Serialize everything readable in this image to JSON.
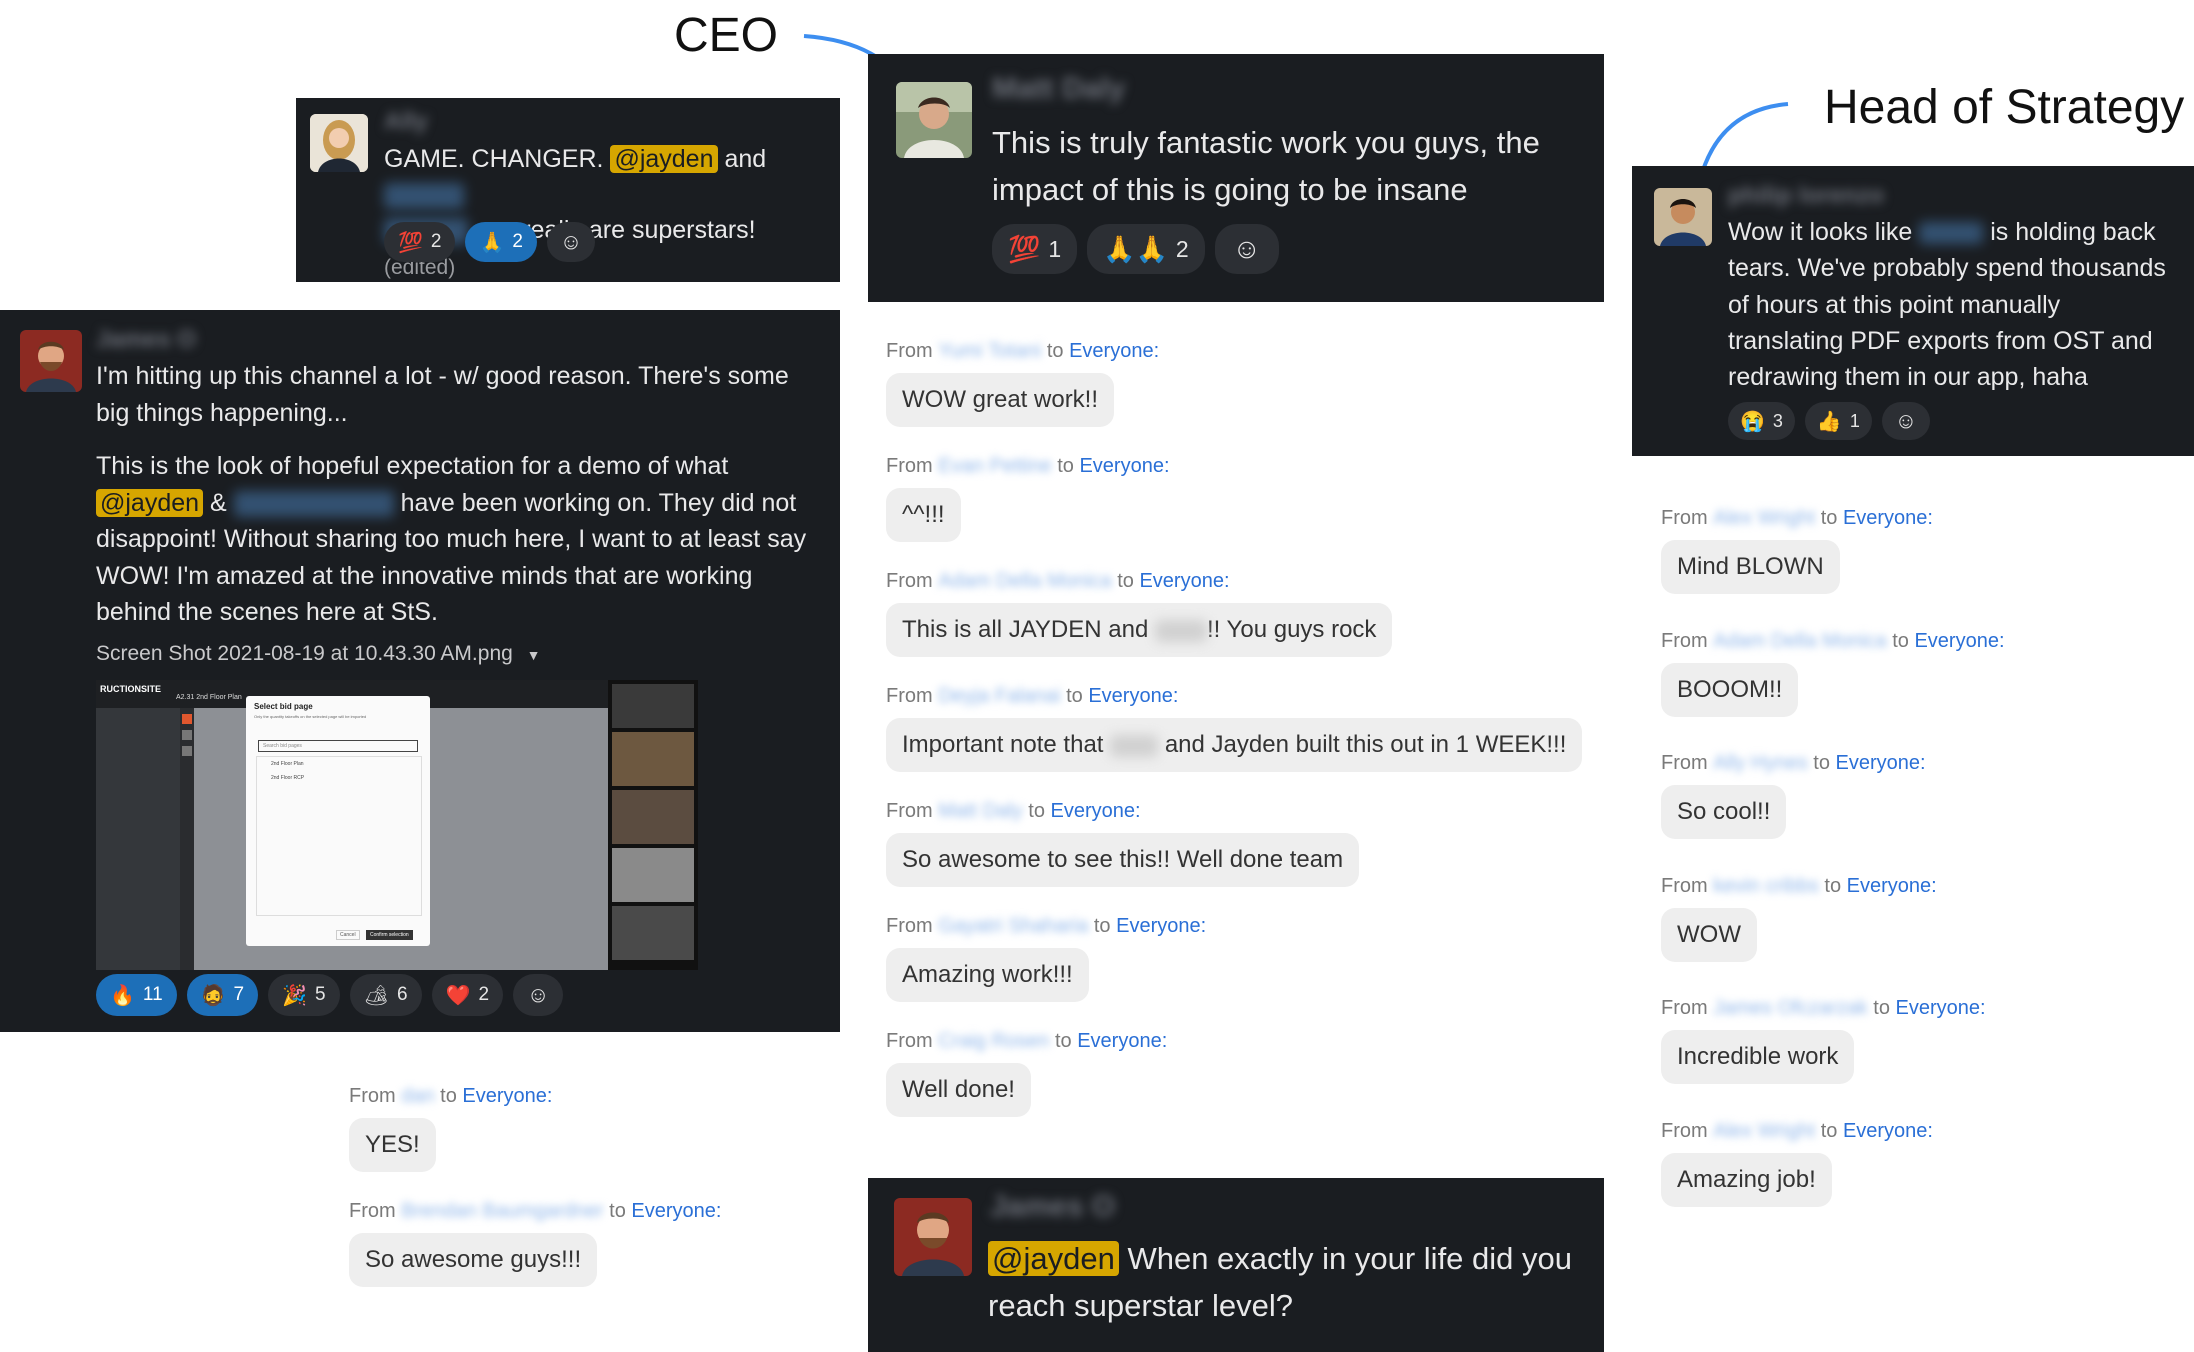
{
  "annotations": {
    "ceo": "CEO",
    "head_of_strategy": "Head of Strategy"
  },
  "card_top_left": {
    "username": "Ally",
    "text_a": "GAME. CHANGER.",
    "mention": "@jayden",
    "text_b": "and",
    "text_c": "you really are superstars!",
    "edited": "(edited)",
    "reactions": [
      {
        "emoji": "💯",
        "count": "2",
        "active": false
      },
      {
        "emoji": "🙏",
        "count": "2",
        "active": true
      }
    ]
  },
  "card_ceo": {
    "username": "Matt Daly",
    "text": "This is truly fantastic work you guys, the impact of this is going to be insane",
    "reactions": [
      {
        "emoji": "💯",
        "count": "1"
      },
      {
        "emoji": "🙏🙏",
        "count": "2"
      }
    ]
  },
  "card_strategy": {
    "username": "philip lorenzo",
    "text_a": "Wow it looks like",
    "text_b": "is holding back tears. We've probably spend thousands of hours at this point manually translating PDF exports from OST and redrawing them in our app, haha",
    "reactions": [
      {
        "emoji": "😭",
        "count": "3"
      },
      {
        "emoji": "👍",
        "count": "1"
      }
    ]
  },
  "card_james": {
    "username": "James O",
    "para1": "I'm hitting up this channel a lot - w/ good reason. There's some big things happening...",
    "para2_a": "This is the look of hopeful expectation for a demo of what",
    "mention": "@jayden",
    "amp": "&",
    "para2_b": "have been working on. They did not disappoint! Without sharing too much here, I want to at least say WOW! I'm amazed at the innovative minds that are working behind the scenes here at StS.",
    "file_name": "Screen Shot 2021-08-19 at 10.43.30 AM.png",
    "thumbnail": {
      "logo": "RUCTIONSITE",
      "title": "A2.31 2nd Floor Plan",
      "dialog_title": "Select bid page",
      "dialog_sub": "Only the quantity takeoffs on the selected page will be imported",
      "search_placeholder": "Search bid pages",
      "options": [
        "2nd Floor Plan",
        "2nd Floor RCP"
      ],
      "cancel": "Cancel",
      "confirm": "Confirm selection"
    },
    "reactions": [
      {
        "emoji": "🔥",
        "count": "11",
        "active": true
      },
      {
        "emoji": "🧔",
        "count": "7",
        "active": true
      },
      {
        "emoji": "🎉",
        "count": "5",
        "active": false
      },
      {
        "emoji": "🏕",
        "count": "6",
        "active": false
      },
      {
        "emoji": "❤️",
        "count": "2",
        "active": false
      }
    ]
  },
  "card_bottom": {
    "username": "James O",
    "mention": "@jayden",
    "text": "When exactly in your life did you reach superstar level?"
  },
  "chat_common": {
    "from": "From",
    "to": "to",
    "everyone": "Everyone:"
  },
  "chat_left": [
    {
      "sender": "dan",
      "message": "YES!"
    },
    {
      "sender": "Brendan Baumgardner",
      "message": "So awesome guys!!!"
    }
  ],
  "chat_middle": [
    {
      "sender": "Yumi Totani",
      "message": "WOW great work!!"
    },
    {
      "sender": "Evan Pettine",
      "message": "^^!!!"
    },
    {
      "sender": "Adam Della Monica",
      "message_a": "This is all JAYDEN and",
      "message_b": "!! You guys rock"
    },
    {
      "sender": "Deyja Falanai",
      "message_a": "Important note that",
      "message_b": "and Jayden built this out in 1 WEEK!!!"
    },
    {
      "sender": "Matt Daly",
      "message": "So awesome to see this!! Well done team"
    },
    {
      "sender": "Gayatri Shaharia",
      "message": "Amazing work!!!"
    },
    {
      "sender": "Craig Rosen",
      "message": "Well done!"
    }
  ],
  "chat_right": [
    {
      "sender": "Alex Wright",
      "message": "Mind BLOWN"
    },
    {
      "sender": "Adam Della Monica",
      "message": "BOOOM!!"
    },
    {
      "sender": "Ally Hynes",
      "message": "So cool!!"
    },
    {
      "sender": "kevin cribbs",
      "message": "WOW"
    },
    {
      "sender": "James Ofczarzak",
      "message": "Incredible work"
    },
    {
      "sender": "Alex Wright",
      "message": "Amazing job!"
    }
  ]
}
